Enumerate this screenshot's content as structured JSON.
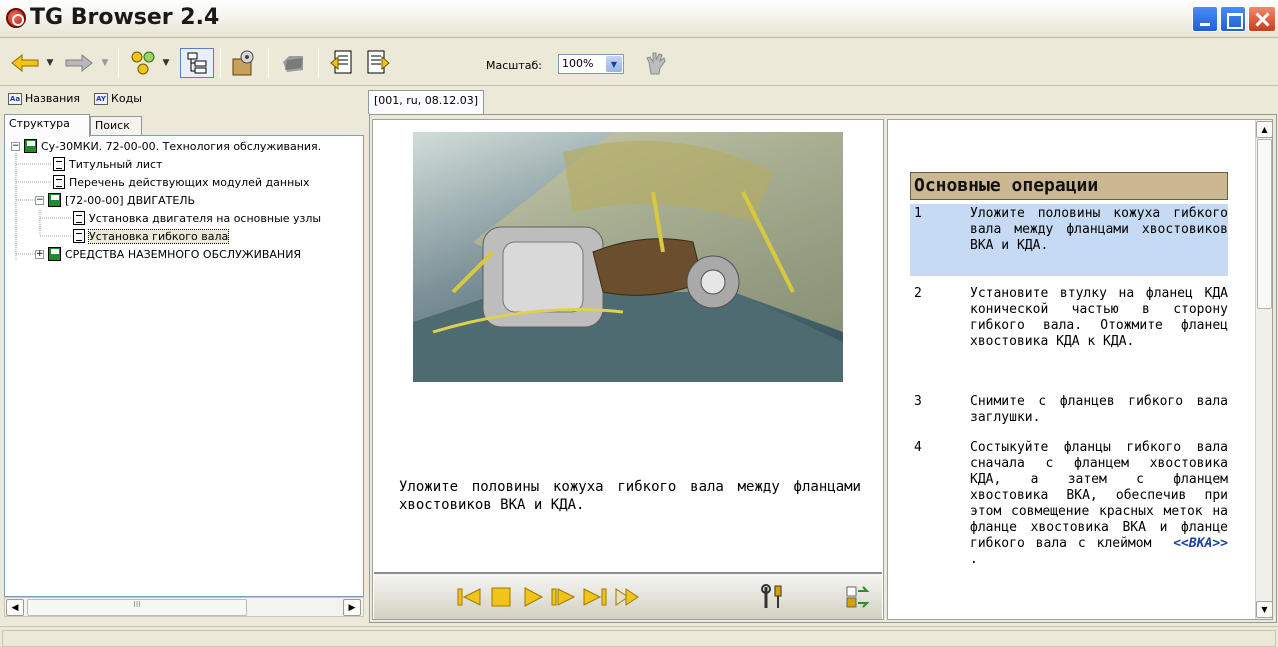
{
  "app": {
    "title": "TG Browser 2.4"
  },
  "toolbar": {
    "back_icon": "arrow-left-icon",
    "forward_icon": "arrow-right-icon",
    "scale_label": "Масштаб:",
    "scale_value": "100%"
  },
  "left": {
    "view_tabs": [
      {
        "label": "Названия"
      },
      {
        "label": "Коды"
      }
    ],
    "panel_tabs": [
      {
        "label": "Структура"
      },
      {
        "label": "Поиск"
      }
    ],
    "tree": {
      "root": "Су-30МКИ. 72-00-00. Технология обслуживания.",
      "items": [
        "Титульный лист",
        "Перечень действующих модулей данных",
        "[72-00-00]  ДВИГАТЕЛЬ",
        "Установка двигателя на основные узлы",
        "Установка гибкого вала",
        "СРЕДСТВА НАЗЕМНОГО ОБСЛУЖИВАНИЯ"
      ]
    },
    "scroll_grip": "III"
  },
  "document": {
    "tab_label": "[001, ru, 08.12.03]",
    "caption": "Уложите половины кожуха гибкого вала между фланцами хвостовиков ВКА и КДА."
  },
  "steps": {
    "header": "Основные операции",
    "items": [
      {
        "num": "1",
        "text": "Уложите половины кожуха гибкого вала между фланцами хвостовиков ВКА и КДА."
      },
      {
        "num": "2",
        "text": "Установите втулку на фланец КДА конической частью в сторону гибкого вала. Отожмите фланец хвостовика КДА к КДА."
      },
      {
        "num": "3",
        "text": "Снимите с фланцев гибкого вала заглушки."
      },
      {
        "num": "4",
        "text": "Состыкуйте фланцы гибкого вала сначала с фланцем хвостовика КДА, а затем с фланцем хвостовика ВКА, обеспечив при этом совмещение красных меток на фланце хвостовика ВКА и фланце гибкого вала с клеймом",
        "mark": "<<ВКА>>",
        "tail": " ."
      }
    ]
  }
}
